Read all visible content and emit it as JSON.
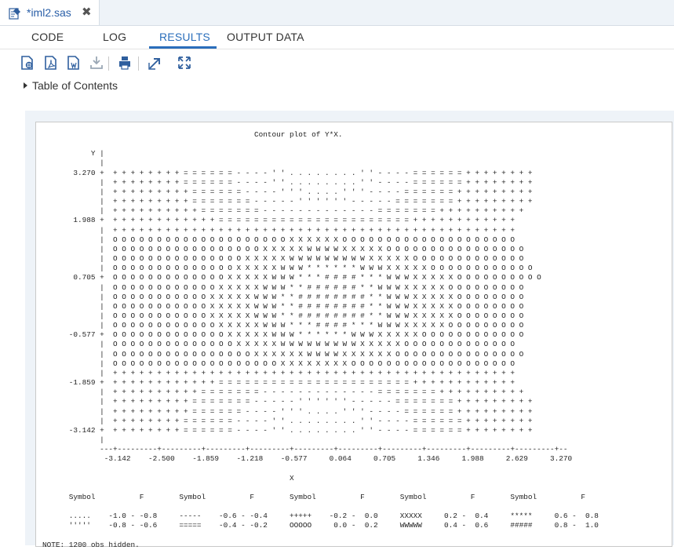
{
  "file_tab": {
    "name": "*iml2.sas",
    "close": "✖"
  },
  "subtabs": [
    "CODE",
    "LOG",
    "RESULTS",
    "OUTPUT DATA"
  ],
  "active_subtab": "RESULTS",
  "toolbar_icons": [
    "html-output-icon",
    "pdf-output-icon",
    "rtf-output-icon",
    "download-icon",
    "print-icon",
    "open-in-new-window-icon",
    "expand-icon"
  ],
  "toc_label": "Table of Contents",
  "accent_color": "#2a6ebb",
  "output": {
    "listing": "                                                Contour plot of Y*X.\n\n           Y |\n             |\n       3.270 +  + + + + + + + + = = = = = = - - - - ' ' . . . . . . . . ' ' - - - - = = = = = = + + + + + + + +\n             |  + + + + + + + + = = = = = = - - - - ' ' . . . . . . . . ' ' - - - - = = = = = = + + + + + + + +\n             |  + + + + + + + + + = = = = = = - - - - ' ' ' . . . . ' ' ' - - - - = = = = = = + + + + + + + + +\n             |  + + + + + + + + + = = = = = = = - - - - - ' ' ' ' ' ' - - - - - = = = = = = = + + + + + + + + +\n             |  + + + + + + + + + + = = = = = = = - - - - - - - - - - - - - = = = = = = = + + + + + + + + + +\n       1.988 +  + + + + + + + + + + + + = = = = = = = = = = = = = = = = = = = = = = + + + + + + + + + + + +\n             |  + + + + + + + + + + + + + + + + + + + + + + + + + + + + + + + + + + + + + + + + + + + + + +\n             |  O O O O O O O O O O O O O O O O O O O O X X X X X X O O O O O O O O O O O O O O O O O O O O\n             |  O O O O O O O O O O O O O O O O O X X X X X W W W W X X X X X O O O O O O O O O O O O O O O O\n             |  O O O O O O O O O O O O O O O X X X X X W W W W W W W W W X X X X X O O O O O O O O O O O O O\n             |  O O O O O O O O O O O O O O X X X X X W W W * * * * * * W W W X X X X X O O O O O O O O O O O O\n       0.705 +  O O O O O O O O O O O O O X X X X X W W W * * * # # # # * * * W W W X X X X X O O O O O O O O O O\n             |  O O O O O O O O O O O O X X X X X W W W * * # # # # # # * * W W W X X X X X O O O O O O O O O\n             |  O O O O O O O O O O O X X X X X W W W * * # # # # # # # # * * W W W X X X X X O O O O O O O O\n             |  O O O O O O O O O O O X X X X X W W W * * # # # # # # # # * * W W W X X X X X O O O O O O O O\n             |  O O O O O O O O O O O X X X X X W W W * * # # # # # # # # * * W W W X X X X X O O O O O O O O\n             |  O O O O O O O O O O O O X X X X X W W W * * * # # # # * * * W W W X X X X X O O O O O O O O O\n      -0.577 +  O O O O O O O O O O O O O X X X X X W W W * * * * * * W W W X X X X X O O O O O O O O O O O O\n             |  O O O O O O O O O O O O O O X X X X X W W W W W W W W W X X X X X O O O O O O O O O O O O O\n             |  O O O O O O O O O O O O O O O O X X X X X X W W W W X X X X X X O O O O O O O O O O O O O O O\n             |  O O O O O O O O O O O O O O O O O O O X X X X X X X X O O O O O O O O O O O O O O O O O O O\n             |  + + + + + + + + + + + + + + + + + + + + + + + + + + + + + + + + + + + + + + + + + + + + + +\n      -1.859 +  + + + + + + + + + + + + = = = = = = = = = = = = = = = = = = = = = = + + + + + + + + + + + +\n             |  + + + + + + + + + + = = = = = = = - - - - - - - - - - - - - = = = = = = = + + + + + + + + + +\n             |  + + + + + + + + + = = = = = = = - - - - - ' ' ' ' ' ' - - - - - = = = = = = = + + + + + + + + +\n             |  + + + + + + + + + = = = = = = - - - - ' ' ' . . . . ' ' ' - - - - = = = = = = + + + + + + + + +\n             |  + + + + + + + + = = = = = = - - - - ' ' . . . . . . . . ' ' - - - - = = = = = = + + + + + + + +\n      -3.142 +  + + + + + + + + = = = = = = - - - - ' ' . . . . . . . . ' ' - - - - = = = = = = + + + + + + + +\n             |\n             ---+---------+---------+---------+---------+---------+---------+---------+---------+---------+---------+--\n              -3.142    -2.500    -1.859    -1.218    -0.577     0.064     0.705     1.346     1.988     2.629     3.270\n\n                                                        X\n\n      Symbol          F        Symbol          F        Symbol          F        Symbol          F        Symbol          F\n\n      .....    -1.0 - -0.8     -----    -0.6 - -0.4     +++++    -0.2 -  0.0     XXXXX     0.2 -  0.4     *****     0.6 -  0.8\n      '''''    -0.8 - -0.6     =====    -0.4 - -0.2     OOOOO     0.0 -  0.2     WWWWW     0.4 -  0.6     #####     0.8 -  1.0\n\nNOTE: 1200 obs hidden."
  }
}
